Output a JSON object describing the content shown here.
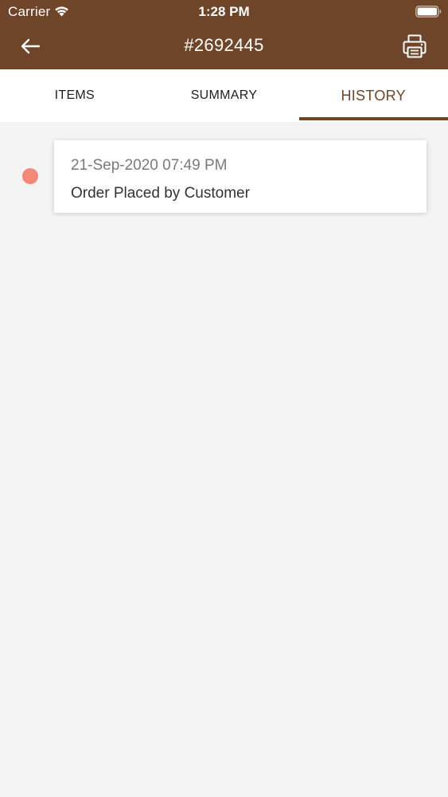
{
  "status_bar": {
    "carrier": "Carrier",
    "time": "1:28 PM",
    "wifi_icon": "wifi-icon",
    "battery_icon": "battery-icon"
  },
  "nav": {
    "back_icon": "arrow-left-icon",
    "title": "#2692445",
    "print_icon": "printer-icon"
  },
  "tabs": [
    {
      "label": "ITEMS",
      "active": false
    },
    {
      "label": "SUMMARY",
      "active": false
    },
    {
      "label": "HISTORY",
      "active": true
    }
  ],
  "history": [
    {
      "datetime": "21-Sep-2020 07:49 PM",
      "description": "Order Placed by Customer",
      "dot_color": "#f2877a"
    }
  ],
  "colors": {
    "brand": "#6f4529",
    "background": "#f5f4f4",
    "timeline_dot": "#f2877a"
  }
}
